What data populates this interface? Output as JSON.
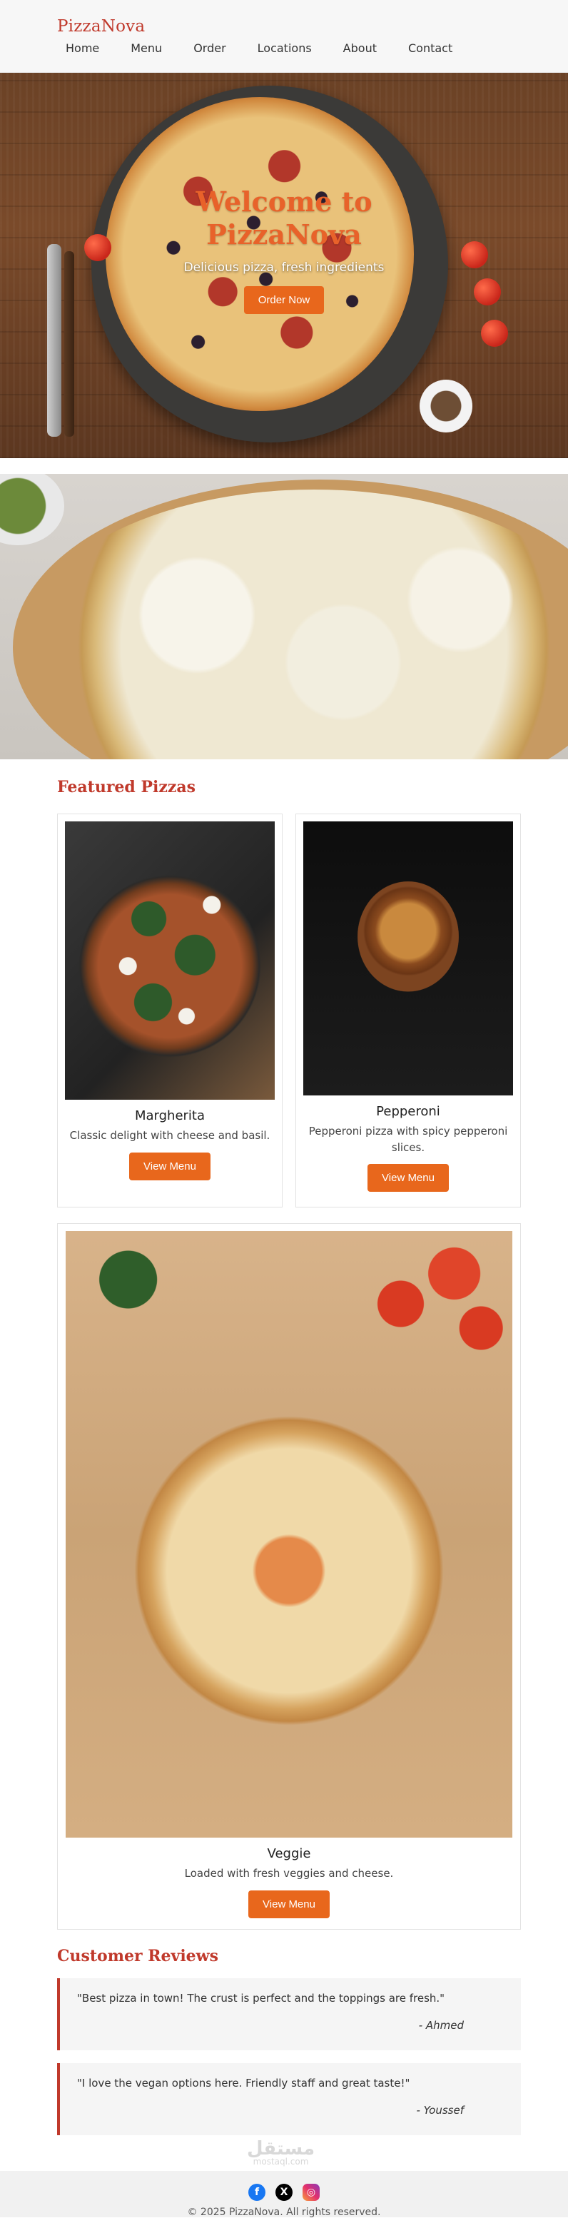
{
  "header": {
    "logo": "PizzaNova",
    "nav": [
      "Home",
      "Menu",
      "Order",
      "Locations",
      "About",
      "Contact"
    ]
  },
  "hero": {
    "title": "Welcome to PizzaNova",
    "subtitle": "Delicious pizza, fresh ingredients",
    "button": "Order Now"
  },
  "featured": {
    "title": "Featured Pizzas",
    "pizzas": [
      {
        "name": "Margherita",
        "description": "Classic delight with cheese and basil.",
        "button": "View Menu"
      },
      {
        "name": "Pepperoni",
        "description": "Pepperoni pizza with spicy pepperoni slices.",
        "button": "View Menu"
      },
      {
        "name": "Veggie",
        "description": "Loaded with fresh veggies and cheese.",
        "button": "View Menu"
      }
    ]
  },
  "reviews": {
    "title": "Customer Reviews",
    "items": [
      {
        "text": "\"Best pizza in town! The crust is perfect and the toppings are fresh.\"",
        "author": "- Ahmed"
      },
      {
        "text": "\"I love the vegan options here. Friendly staff and great taste!\"",
        "author": "- Youssef"
      }
    ]
  },
  "footer": {
    "social": [
      {
        "icon": "facebook-icon",
        "glyph": "f"
      },
      {
        "icon": "x-icon",
        "glyph": "X"
      },
      {
        "icon": "instagram-icon",
        "glyph": "◎"
      }
    ],
    "copyright": "© 2025 PizzaNova. All rights reserved."
  },
  "watermark": {
    "arabic": "مستقل",
    "latin": "mostaql.com"
  },
  "colors": {
    "accent": "#c0392b",
    "button": "#e8671c",
    "hero_title": "#e8622a"
  }
}
